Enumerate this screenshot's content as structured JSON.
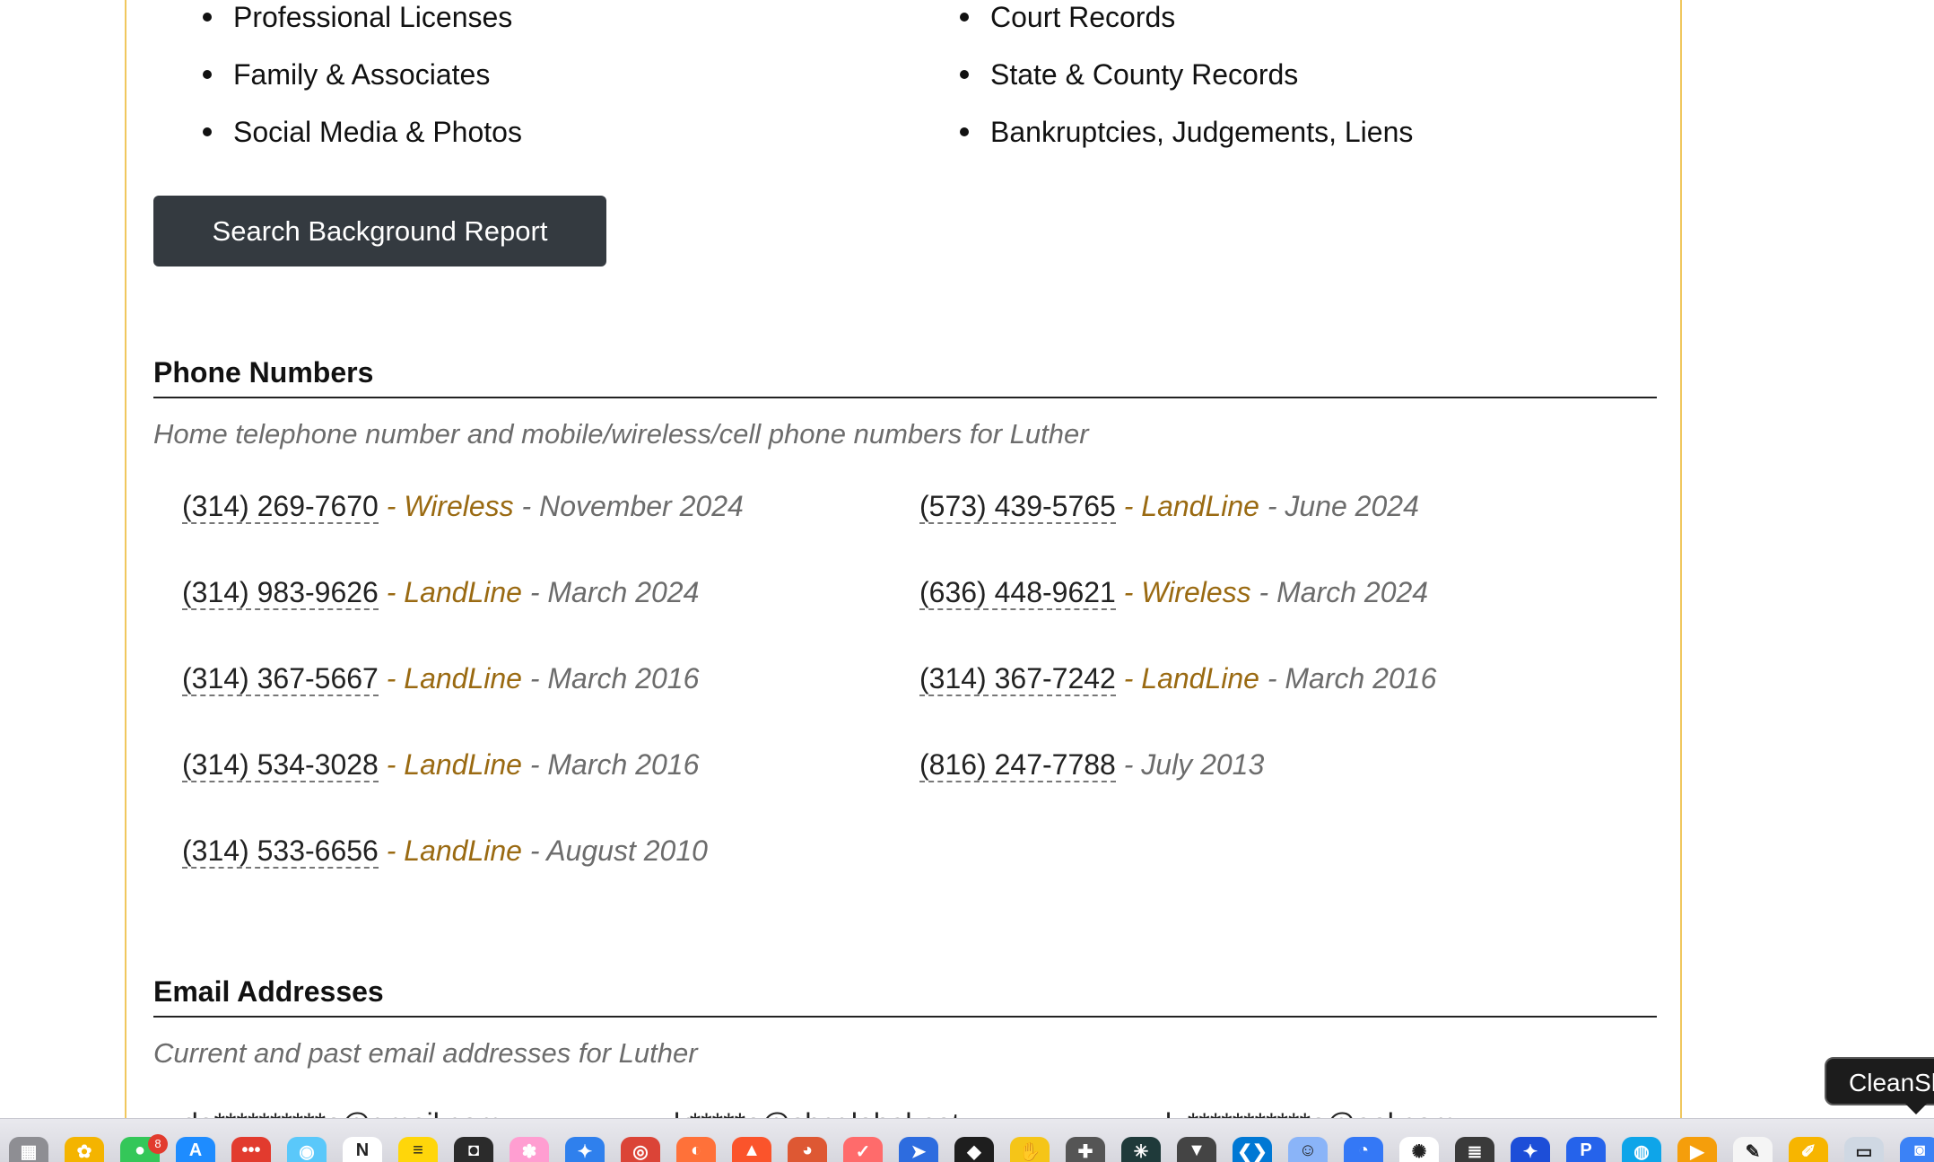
{
  "features": {
    "left": [
      "Professional Licenses",
      "Family & Associates",
      "Social Media & Photos"
    ],
    "right": [
      "Court Records",
      "State & County Records",
      "Bankruptcies, Judgements, Liens"
    ]
  },
  "search_button": {
    "label": "Search Background Report"
  },
  "phone_section": {
    "title": "Phone Numbers",
    "description": "Home telephone number and mobile/wireless/cell phone numbers for Luther",
    "entries": [
      {
        "number": "(314) 269-7670",
        "type": "Wireless",
        "date": "November 2024"
      },
      {
        "number": "(573) 439-5765",
        "type": "LandLine",
        "date": "June 2024"
      },
      {
        "number": "(314) 983-9626",
        "type": "LandLine",
        "date": "March 2024"
      },
      {
        "number": "(636) 448-9621",
        "type": "Wireless",
        "date": "March 2024"
      },
      {
        "number": "(314) 367-5667",
        "type": "LandLine",
        "date": "March 2016"
      },
      {
        "number": "(314) 367-7242",
        "type": "LandLine",
        "date": "March 2016"
      },
      {
        "number": "(314) 534-3028",
        "type": "LandLine",
        "date": "March 2016"
      },
      {
        "number": "(816) 247-7788",
        "type": "",
        "date": "July 2013"
      },
      {
        "number": "(314) 533-6656",
        "type": "LandLine",
        "date": "August 2010"
      }
    ]
  },
  "email_section": {
    "title": "Email Addresses",
    "description": "Current and past email addresses for Luther",
    "entries": [
      "de**********e@gmail.com",
      "lr*****e@sbcglobal.net",
      "lu***********e@aol.com"
    ]
  },
  "tooltip": {
    "text": "CleanShot"
  },
  "dock": {
    "badge_count": "8",
    "icons": [
      {
        "name": "launchpad-icon",
        "color": "#8e8e93",
        "glyph": "▦"
      },
      {
        "name": "photos-icon",
        "color": "#f4b400",
        "glyph": "✿"
      },
      {
        "name": "messages-icon",
        "color": "#34c759",
        "glyph": "●"
      },
      {
        "name": "app-store-icon",
        "color": "#1e8cff",
        "glyph": "A"
      },
      {
        "name": "more-icon",
        "color": "#e23b2e",
        "glyph": "•••"
      },
      {
        "name": "maps-icon",
        "color": "#5ac8fa",
        "glyph": "◉"
      },
      {
        "name": "notion-icon",
        "color": "#ffffff",
        "glyph": "N"
      },
      {
        "name": "notes-icon",
        "color": "#ffd60a",
        "glyph": "≡"
      },
      {
        "name": "robot-icon",
        "color": "#2b2b2b",
        "glyph": "◘"
      },
      {
        "name": "flower-app-icon",
        "color": "#ff9ed1",
        "glyph": "✽"
      },
      {
        "name": "safari-icon",
        "color": "#2f80ed",
        "glyph": "✦"
      },
      {
        "name": "chrome-icon",
        "color": "#db4437",
        "glyph": "◎"
      },
      {
        "name": "firefox-icon",
        "color": "#ff7139",
        "glyph": "◐"
      },
      {
        "name": "brave-icon",
        "color": "#fb542b",
        "glyph": "▲"
      },
      {
        "name": "duckduckgo-icon",
        "color": "#de5833",
        "glyph": "◕"
      },
      {
        "name": "tasks-icon",
        "color": "#ff6b6b",
        "glyph": "✓"
      },
      {
        "name": "arrow-app-icon",
        "color": "#2d6cdf",
        "glyph": "➤"
      },
      {
        "name": "figma-icon",
        "color": "#1e1e1e",
        "glyph": "◆"
      },
      {
        "name": "hand-app-icon",
        "color": "#f5c518",
        "glyph": "✋"
      },
      {
        "name": "tool-app-icon",
        "color": "#555555",
        "glyph": "✚"
      },
      {
        "name": "perplexity-icon",
        "color": "#1f3a3a",
        "glyph": "✳"
      },
      {
        "name": "bear-icon",
        "color": "#444444",
        "glyph": "▼"
      },
      {
        "name": "vscode-icon",
        "color": "#0078d4",
        "glyph": "❮❯"
      },
      {
        "name": "finder-icon",
        "color": "#8ab4f8",
        "glyph": "☺"
      },
      {
        "name": "chat-app-icon",
        "color": "#3478f6",
        "glyph": "◔"
      },
      {
        "name": "openai-icon",
        "color": "#ffffff",
        "glyph": "✺"
      },
      {
        "name": "writer-app-icon",
        "color": "#3a3a3a",
        "glyph": "≣"
      },
      {
        "name": "pin-app-icon",
        "color": "#1d4ed8",
        "glyph": "✦"
      },
      {
        "name": "proxyman-icon",
        "color": "#2563eb",
        "glyph": "P"
      },
      {
        "name": "browser-app-icon",
        "color": "#0ea5e9",
        "glyph": "◍"
      },
      {
        "name": "player-app-icon",
        "color": "#f59e0b",
        "glyph": "▶"
      },
      {
        "name": "textedit-icon",
        "color": "#f5f5f5",
        "glyph": "✎"
      },
      {
        "name": "pencil-app-icon",
        "color": "#f7b500",
        "glyph": "✐"
      },
      {
        "name": "preview-icon",
        "color": "#cfd8e3",
        "glyph": "▭"
      },
      {
        "name": "screenshot-app-icon",
        "color": "#3b82f6",
        "glyph": "◙"
      }
    ]
  }
}
